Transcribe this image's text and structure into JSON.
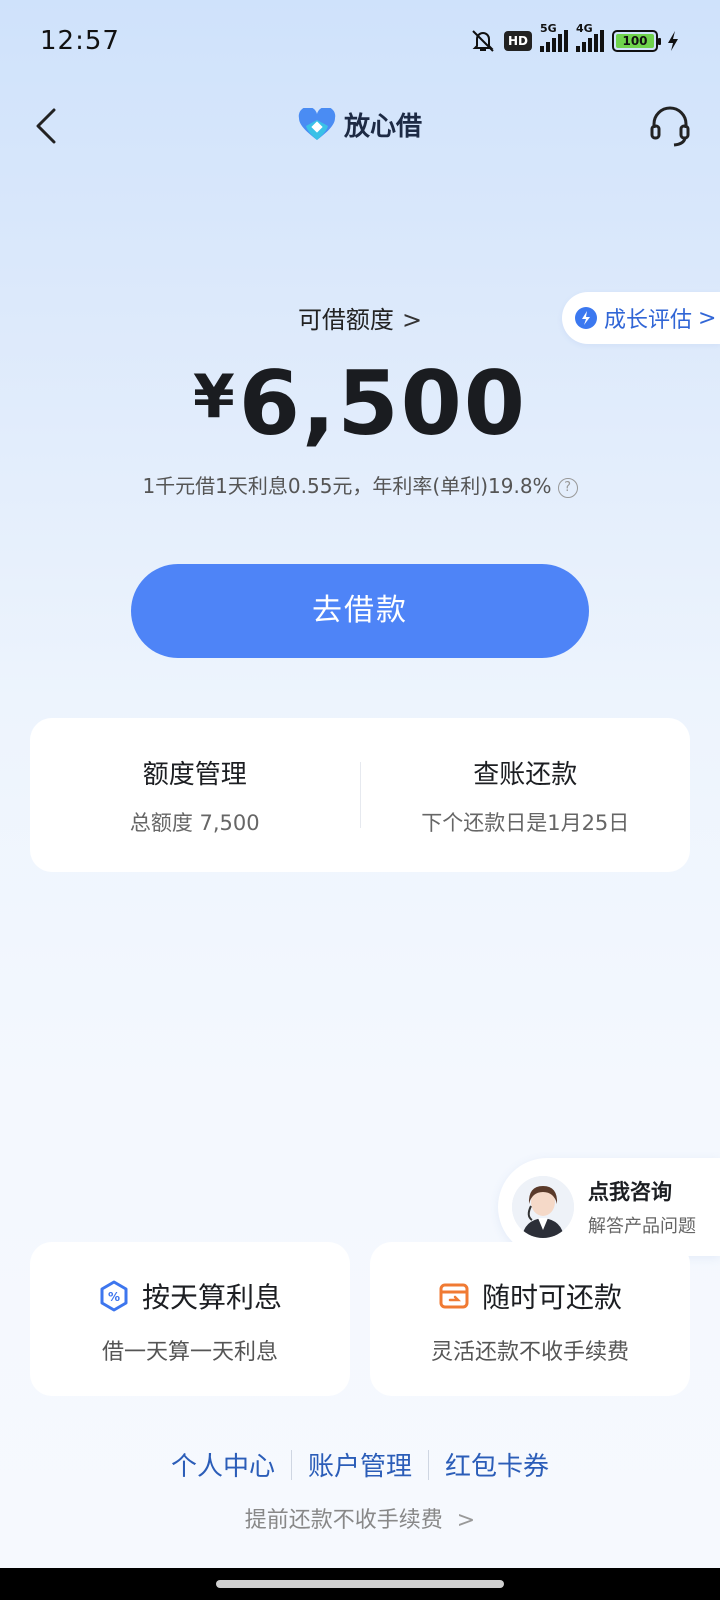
{
  "status_bar": {
    "time": "12:57",
    "hd_badge": "HD",
    "signal1_label": "5G",
    "signal2_label": "4G",
    "battery": "100"
  },
  "nav": {
    "brand": "放心借"
  },
  "growth": {
    "label": "成长评估",
    "chevron": ">"
  },
  "credit": {
    "label": "可借额度",
    "label_arrow": ">",
    "currency": "¥",
    "amount": "6,500",
    "rate_text": "1千元借1天利息0.55元，年利率(单利)19.8%",
    "help": "?"
  },
  "borrow_button": "去借款",
  "manage": {
    "left_title": "额度管理",
    "left_sub": "总额度 7,500",
    "right_title": "查账还款",
    "right_sub": "下个还款日是1月25日"
  },
  "consult": {
    "title": "点我咨询",
    "sub": "解答产品问题"
  },
  "features": {
    "left_title": "按天算利息",
    "left_sub": "借一天算一天利息",
    "right_title": "随时可还款",
    "right_sub": "灵活还款不收手续费"
  },
  "footer": {
    "links": [
      "个人中心",
      "账户管理",
      "红包卡券"
    ],
    "prepay_text": "提前还款不收手续费",
    "prepay_chevron": ">"
  },
  "colors": {
    "accent": "#4e84f7",
    "link": "#2b5db8"
  }
}
